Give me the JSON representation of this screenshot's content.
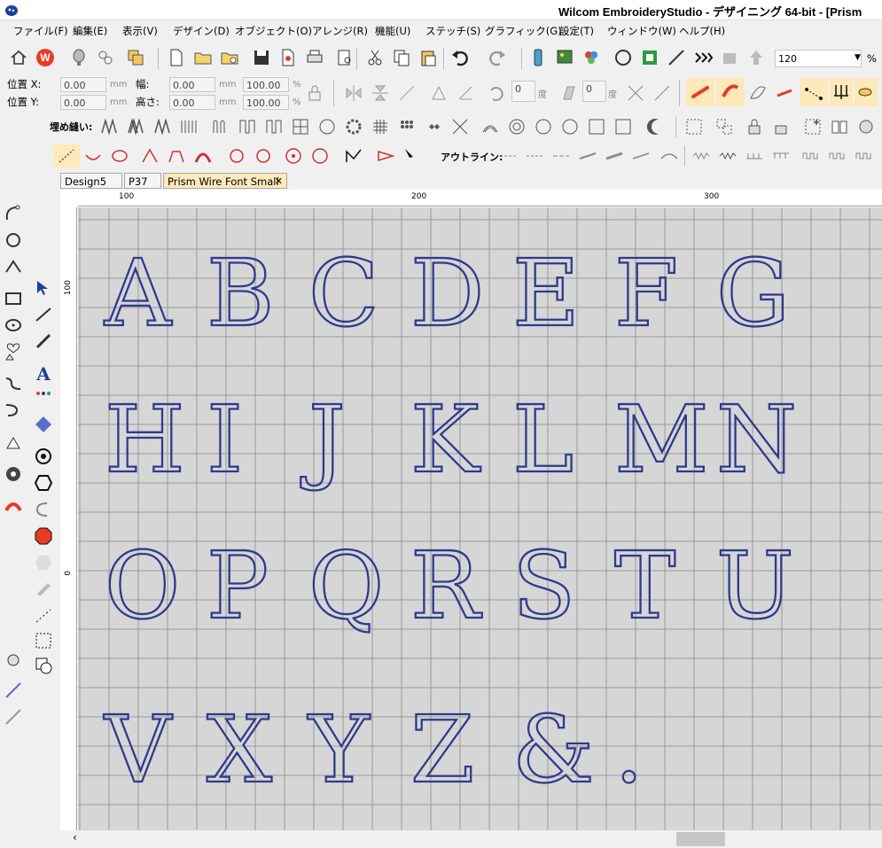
{
  "window": {
    "title": "Wilcom EmbroideryStudio - デザイニング 64-bit - [Prism"
  },
  "menu": [
    "ファイル(F)",
    "編集(E)",
    "表示(V)",
    "デザイン(D)",
    "オブジェクト(O)",
    "アレンジ(R)",
    "機能(U)",
    "ステッチ(S)",
    "グラフィック(G)",
    "設定(T)",
    "ウィンドウ(W)",
    "ヘルプ(H)"
  ],
  "zoom": {
    "value": "120",
    "unit": "%"
  },
  "position": {
    "x_label": "位置 X:",
    "y_label": "位置 Y:",
    "x_value": "0.00",
    "y_value": "0.00",
    "unit": "mm",
    "w_label": "幅:",
    "h_label": "高さ:",
    "w_value": "0.00",
    "h_value": "0.00",
    "w_pct": "100.00",
    "h_pct": "100.00",
    "pct_unit": "%"
  },
  "rotate": {
    "value": "0",
    "unit": "度"
  },
  "slant": {
    "value": "0",
    "unit": "度"
  },
  "fill_label": "埋め縫い:",
  "outline_label": "アウトライン:",
  "tabs": [
    "Design5",
    "P37",
    "Prism Wire Font Small"
  ],
  "tab_close": "✕",
  "ruler": {
    "h": [
      "100",
      "200",
      "300"
    ],
    "v": [
      "100",
      "0"
    ]
  },
  "letters": [
    "A",
    "B",
    "C",
    "D",
    "E",
    "F",
    "G",
    "H",
    "I",
    "J",
    "K",
    "L",
    "M",
    "N",
    "O",
    "P",
    "Q",
    "R",
    "S",
    "T",
    "U",
    "V",
    "X",
    "Y",
    "Z",
    "&",
    "."
  ],
  "colors": {
    "stitch": "#2e3a8c",
    "grid": "#999999",
    "canvas": "#d6d6d6",
    "active_tab": "#fde9b9"
  }
}
